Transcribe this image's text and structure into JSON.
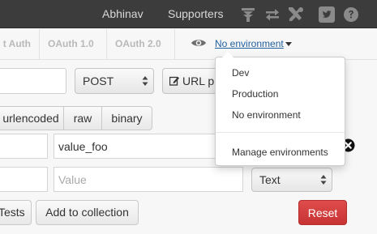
{
  "header": {
    "user": "Abhinav",
    "supporters": "Supporters",
    "icons": [
      "interceptor-icon",
      "sync-icon",
      "tools-icon",
      "twitter-icon",
      "help-icon"
    ]
  },
  "auth": {
    "tabs": [
      "t Auth",
      "OAuth 1.0",
      "OAuth 2.0"
    ]
  },
  "environment": {
    "selected": "No environment",
    "icon": "eye-icon"
  },
  "request": {
    "method": "POST",
    "url_params_label": "URL p"
  },
  "body_types": [
    "urlencoded",
    "raw",
    "binary"
  ],
  "params": {
    "row1_value": "value_foo",
    "row2_value_placeholder": "Value",
    "row2_type": "Text"
  },
  "actions": {
    "tests": "Tests",
    "add_to_collection": "Add to collection",
    "reset": "Reset"
  },
  "env_dropdown": {
    "items": [
      "Dev",
      "Production",
      "No environment"
    ],
    "manage": "Manage environments"
  },
  "colors": {
    "header_bg": "#3c3c3c",
    "link": "#1f5f9e",
    "reset_bg": "#d23f3f"
  }
}
